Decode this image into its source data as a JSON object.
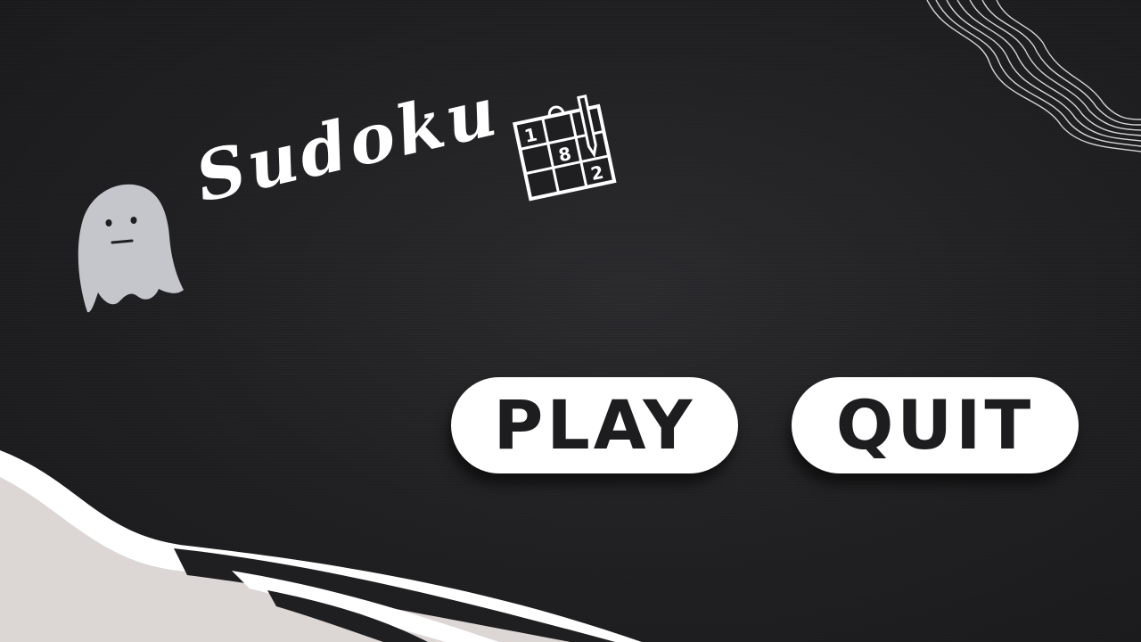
{
  "title": "Sudoku",
  "sudoku_icon": {
    "digits": [
      "1",
      "8",
      "2"
    ]
  },
  "menu": {
    "play_label": "PLAY",
    "quit_label": "QUIT"
  },
  "icons": {
    "mascot": "ghost-icon",
    "logo": "sudoku-grid-icon",
    "decoration": "wavy-lines-decoration"
  },
  "colors": {
    "background": "#1f1f21",
    "button_fill": "#ffffff",
    "button_text": "#1d1d1f",
    "title_text": "#ffffff",
    "ghost_fill": "#c4c6cc",
    "wave_light": "#dcd6d4"
  }
}
